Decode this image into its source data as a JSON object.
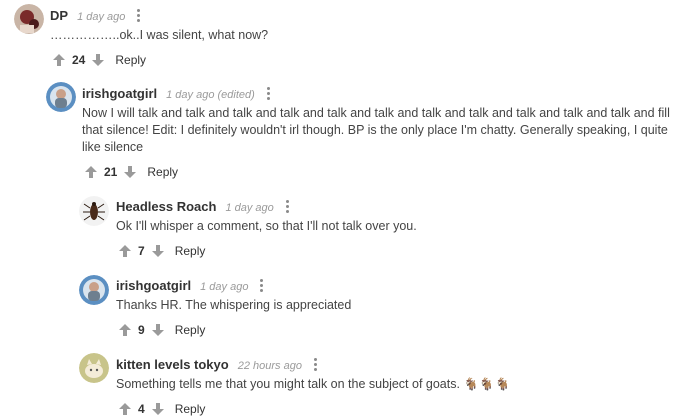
{
  "comments": [
    {
      "user": "DP",
      "time": "1 day ago",
      "edited": "",
      "text": "……………..ok..I was silent, what now?",
      "votes": "24",
      "reply": "Reply",
      "avatar": "dp-avatar-icon"
    },
    {
      "user": "irishgoatgirl",
      "time": "1 day ago (edited)",
      "text": "Now I will talk and talk and talk and talk and talk and talk and talk and talk and talk and talk and talk and fill that silence! Edit: I definitely wouldn't irl though. BP is the only place I'm chatty. Generally speaking, I quite like silence",
      "votes": "21",
      "reply": "Reply",
      "avatar": "irishgoatgirl-avatar-icon"
    },
    {
      "user": "Headless Roach",
      "time": "1 day ago",
      "text": "Ok I'll whisper a comment, so that I'll not talk over you.",
      "votes": "7",
      "reply": "Reply",
      "avatar": "roach-avatar-icon"
    },
    {
      "user": "irishgoatgirl",
      "time": "1 day ago",
      "text": "Thanks HR. The whispering is appreciated",
      "votes": "9",
      "reply": "Reply",
      "avatar": "irishgoatgirl-avatar-icon"
    },
    {
      "user": "kitten levels tokyo",
      "time": "22 hours ago",
      "text": "Something tells me that you might talk on the subject of goats.",
      "emoji": "🐐🐐🐐",
      "votes": "4",
      "reply": "Reply",
      "avatar": "kitten-avatar-icon"
    }
  ],
  "colors": {
    "text": "#444444",
    "meta": "#9a9a9a",
    "arrow": "#9a9a9a"
  }
}
